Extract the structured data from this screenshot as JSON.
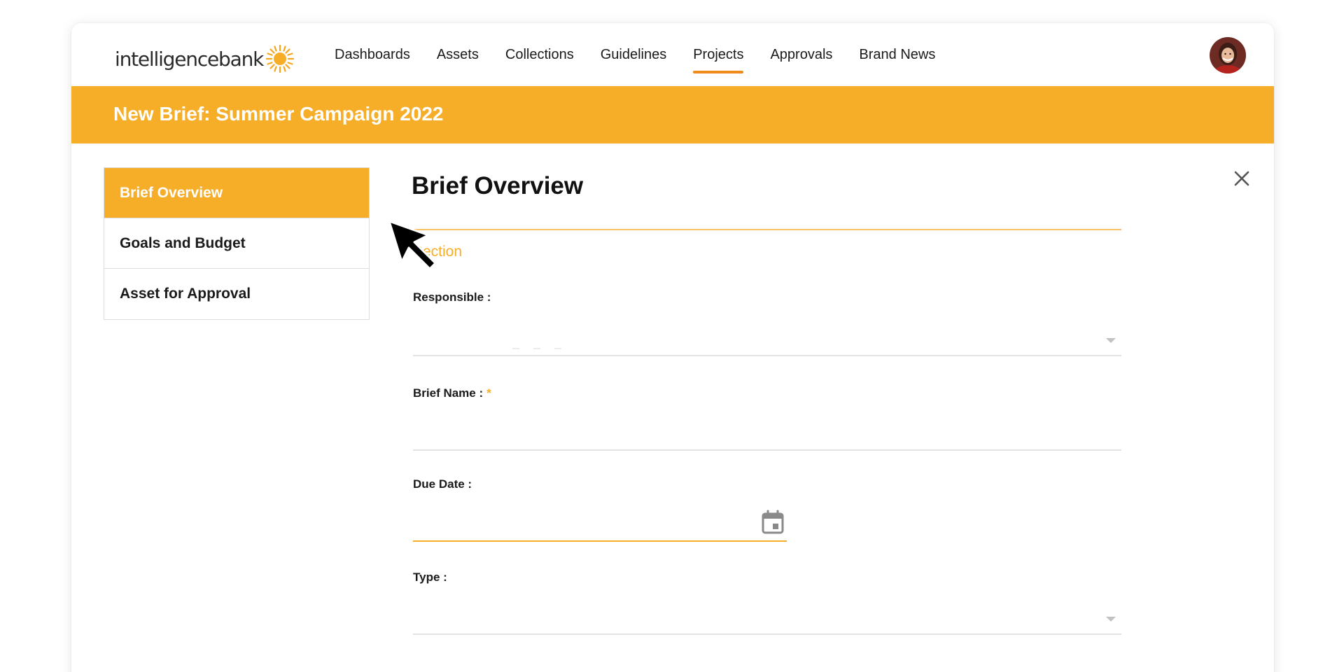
{
  "logo": {
    "text": "intelligencebank"
  },
  "nav": {
    "items": [
      {
        "label": "Dashboards",
        "active": false
      },
      {
        "label": "Assets",
        "active": false
      },
      {
        "label": "Collections",
        "active": false
      },
      {
        "label": "Guidelines",
        "active": false
      },
      {
        "label": "Projects",
        "active": true
      },
      {
        "label": "Approvals",
        "active": false
      },
      {
        "label": "Brand News",
        "active": false
      }
    ]
  },
  "banner": {
    "title": "New Brief: Summer Campaign 2022"
  },
  "sidebar": {
    "items": [
      {
        "label": "Brief Overview",
        "active": true
      },
      {
        "label": "Goals and Budget",
        "active": false
      },
      {
        "label": "Asset for Approval",
        "active": false
      }
    ]
  },
  "form": {
    "title": "Brief Overview",
    "section_label": "Section",
    "fields": {
      "responsible": {
        "label": "Responsible :",
        "value": ""
      },
      "brief_name": {
        "label": "Brief Name :",
        "required_mark": "*",
        "value": ""
      },
      "due_date": {
        "label": "Due Date :",
        "value": ""
      },
      "type": {
        "label": "Type :",
        "value": ""
      }
    }
  },
  "icons": {
    "close": "close-icon",
    "calendar": "calendar-icon",
    "caret": "chevron-down-icon",
    "cursor": "mouse-pointer-icon"
  },
  "colors": {
    "accent": "#f6ae29",
    "nav_underline": "#f08a1c",
    "field_line": "#e3e3e3"
  }
}
